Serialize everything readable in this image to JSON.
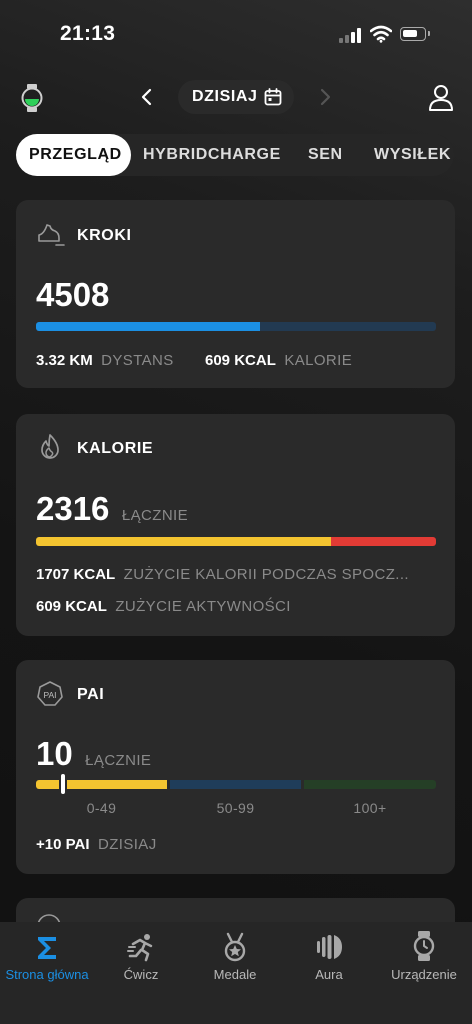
{
  "status_bar": {
    "time": "21:13"
  },
  "header": {
    "date_label": "DZISIAJ"
  },
  "tabs": [
    {
      "label": "PRZEGLĄD",
      "active": true
    },
    {
      "label": "HYBRIDCHARGE"
    },
    {
      "label": "SEN"
    },
    {
      "label": "WYSIŁEK"
    }
  ],
  "steps": {
    "title": "KROKI",
    "value": "4508",
    "progress": 0.56,
    "distance_value": "3.32 KM",
    "distance_label": "DYSTANS",
    "calories_value": "609 KCAL",
    "calories_label": "KALORIE"
  },
  "calories": {
    "title": "KALORIE",
    "value": "2316",
    "value_label": "ŁĄCZNIE",
    "resting_fraction": 0.737,
    "resting_value": "1707 KCAL",
    "resting_label": "ZUŻYCIE KALORII PODCZAS SPOCZ...",
    "active_value": "609 KCAL",
    "active_label": "ZUŻYCIE AKTYWNOŚCI"
  },
  "pai": {
    "title": "PAI",
    "icon_text": "PAI",
    "value": "10",
    "value_label": "ŁĄCZNIE",
    "segments": [
      "0-49",
      "50-99",
      "100+"
    ],
    "today_value": "+10 PAI",
    "today_label": "DZISIAJ",
    "marker_value": 10
  },
  "colors": {
    "steps_fill": "#1b8fe3",
    "steps_track": "#223a52",
    "calories_yellow": "#f4c430",
    "calories_red": "#e23b35",
    "pai_yellow": "#f4c430",
    "pai_blue": "#1f3d5a",
    "pai_green": "#253f26",
    "nav_active": "#1b8fe3"
  },
  "nav": [
    {
      "label": "Strona główna",
      "icon": "sigma-icon",
      "active": true
    },
    {
      "label": "Ćwicz",
      "icon": "running-icon"
    },
    {
      "label": "Medale",
      "icon": "medal-icon"
    },
    {
      "label": "Aura",
      "icon": "aura-icon"
    },
    {
      "label": "Urządzenie",
      "icon": "watch-icon"
    }
  ]
}
